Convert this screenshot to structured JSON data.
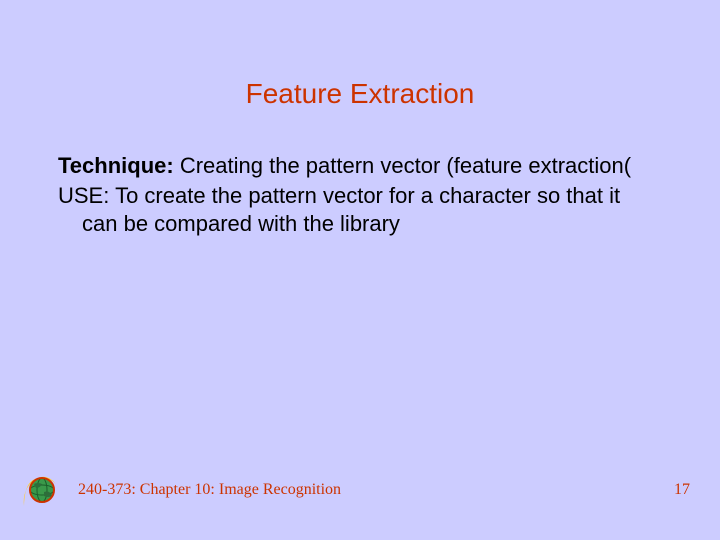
{
  "title": "Feature Extraction",
  "content": {
    "technique_label": "Technique:",
    "technique_text": "  Creating the pattern vector (feature extraction(",
    "use_line1": "USE: To create the pattern vector for a character so that it can be compared with the library"
  },
  "footer": {
    "chapter": "240-373: Chapter 10: Image Recognition",
    "page": "17"
  },
  "icon_name": "globe-logo-icon"
}
